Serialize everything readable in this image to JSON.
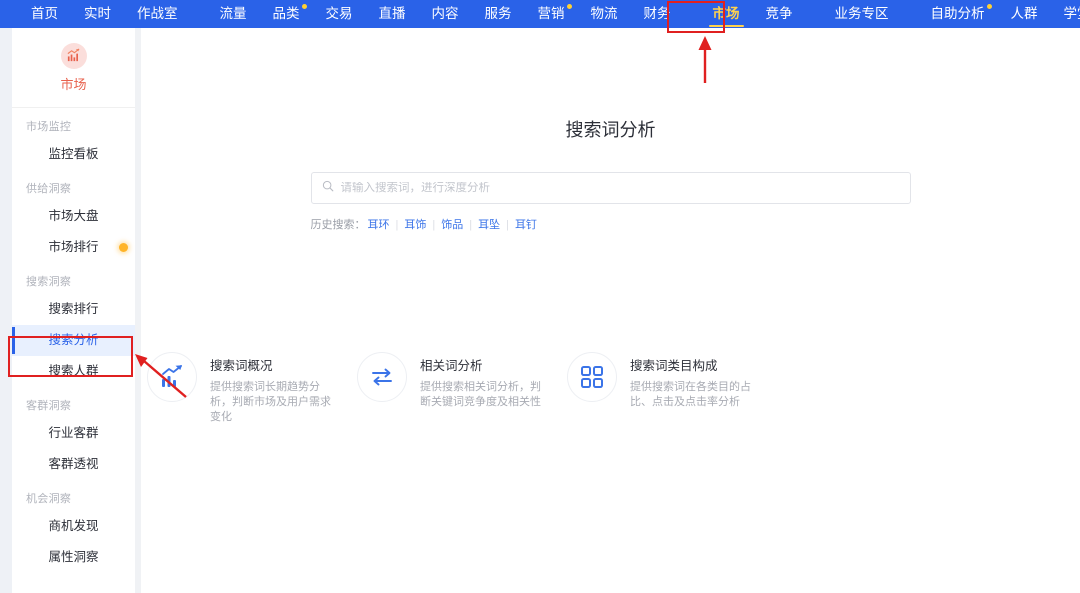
{
  "topnav": {
    "items": [
      {
        "label": "首页",
        "active": false,
        "dot": false,
        "sep_after": false
      },
      {
        "label": "实时",
        "active": false,
        "dot": false,
        "sep_after": false
      },
      {
        "label": "作战室",
        "active": false,
        "dot": false,
        "sep_after": true
      },
      {
        "label": "流量",
        "active": false,
        "dot": false,
        "sep_after": false
      },
      {
        "label": "品类",
        "active": false,
        "dot": true,
        "sep_after": false
      },
      {
        "label": "交易",
        "active": false,
        "dot": false,
        "sep_after": false
      },
      {
        "label": "直播",
        "active": false,
        "dot": false,
        "sep_after": false
      },
      {
        "label": "内容",
        "active": false,
        "dot": false,
        "sep_after": false
      },
      {
        "label": "服务",
        "active": false,
        "dot": false,
        "sep_after": false
      },
      {
        "label": "营销",
        "active": false,
        "dot": true,
        "sep_after": false
      },
      {
        "label": "物流",
        "active": false,
        "dot": false,
        "sep_after": false
      },
      {
        "label": "财务",
        "active": false,
        "dot": false,
        "sep_after": true
      },
      {
        "label": "市场",
        "active": true,
        "dot": false,
        "sep_after": false
      },
      {
        "label": "竞争",
        "active": false,
        "dot": false,
        "sep_after": true
      },
      {
        "label": "业务专区",
        "active": false,
        "dot": false,
        "sep_after": true
      },
      {
        "label": "自助分析",
        "active": false,
        "dot": true,
        "sep_after": false
      },
      {
        "label": "人群",
        "active": false,
        "dot": false,
        "sep_after": false
      },
      {
        "label": "学堂",
        "active": false,
        "dot": false,
        "sep_after": false
      }
    ]
  },
  "sidebar": {
    "logo_label": "市场",
    "logo_icon": "market-chart-icon",
    "groups": [
      {
        "label": "市场监控",
        "items": [
          {
            "label": "监控看板",
            "selected": false,
            "badge": false
          }
        ]
      },
      {
        "label": "供给洞察",
        "items": [
          {
            "label": "市场大盘",
            "selected": false,
            "badge": false
          },
          {
            "label": "市场排行",
            "selected": false,
            "badge": true
          }
        ]
      },
      {
        "label": "搜索洞察",
        "items": [
          {
            "label": "搜索排行",
            "selected": false,
            "badge": false
          },
          {
            "label": "搜索分析",
            "selected": true,
            "badge": false
          },
          {
            "label": "搜索人群",
            "selected": false,
            "badge": false
          }
        ]
      },
      {
        "label": "客群洞察",
        "items": [
          {
            "label": "行业客群",
            "selected": false,
            "badge": false
          },
          {
            "label": "客群透视",
            "selected": false,
            "badge": false
          }
        ]
      },
      {
        "label": "机会洞察",
        "items": [
          {
            "label": "商机发现",
            "selected": false,
            "badge": false
          },
          {
            "label": "属性洞察",
            "selected": false,
            "badge": false
          }
        ]
      }
    ]
  },
  "main": {
    "title": "搜索词分析",
    "search": {
      "placeholder": "请输入搜索词，进行深度分析",
      "value": "",
      "icon": "search-icon"
    },
    "history": {
      "label": "历史搜索：",
      "tags": [
        "耳环",
        "耳饰",
        "饰品",
        "耳坠",
        "耳钉"
      ],
      "divider": "|"
    },
    "features": [
      {
        "icon": "bar-chart-trend-icon",
        "title": "搜索词概况",
        "desc": "提供搜索词长期趋势分析，判断市场及用户需求变化"
      },
      {
        "icon": "exchange-arrows-icon",
        "title": "相关词分析",
        "desc": "提供搜索相关词分析，判断关键词竞争度及相关性"
      },
      {
        "icon": "grid-squares-icon",
        "title": "搜索词类目构成",
        "desc": "提供搜索词在各类目的占比、点击及点击率分析"
      }
    ]
  },
  "annotations": {
    "nav_highlight_label": "市场",
    "sidebar_highlight_label": "搜索分析",
    "color": "#e02020"
  }
}
